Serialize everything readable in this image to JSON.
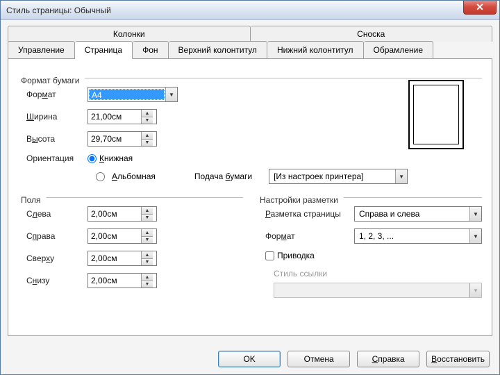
{
  "window": {
    "title": "Стиль страницы: Обычный"
  },
  "tabs_row1": [
    "Колонки",
    "Сноска"
  ],
  "tabs_row2": [
    "Управление",
    "Страница",
    "Фон",
    "Верхний колонтитул",
    "Нижний колонтитул",
    "Обрамление"
  ],
  "paper": {
    "group": "Формат бумаги",
    "format_label": "Формат",
    "format_value": "A4",
    "width_label": "Ширина",
    "width_value": "21,00см",
    "height_label": "Высота",
    "height_value": "29,70см",
    "orientation_label": "Ориентация",
    "portrait": "Книжная",
    "landscape": "Альбомная"
  },
  "feed": {
    "label": "Подача бумаги",
    "value": "[Из настроек принтера]"
  },
  "margins": {
    "group": "Поля",
    "left_label": "Слева",
    "right_label": "Справа",
    "top_label": "Сверху",
    "bottom_label": "Снизу",
    "left": "2,00см",
    "right": "2,00см",
    "top": "2,00см",
    "bottom": "2,00см"
  },
  "layout": {
    "group": "Настройки разметки",
    "page_layout_label": "Разметка страницы",
    "page_layout_value": "Справа и слева",
    "format_label": "Формат",
    "format_value": "1, 2, 3, ...",
    "register_label": "Приводка",
    "ref_style_label": "Стиль ссылки",
    "ref_style_value": ""
  },
  "buttons": {
    "ok": "OK",
    "cancel": "Отмена",
    "help": "Справка",
    "reset": "Восстановить"
  }
}
